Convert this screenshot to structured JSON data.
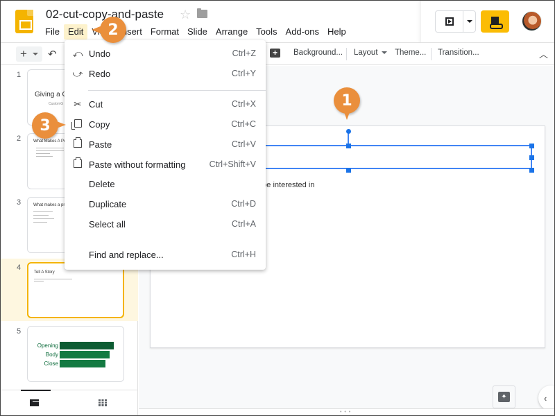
{
  "header": {
    "doc_title": "02-cut-copy-and-paste",
    "menu": [
      "File",
      "Edit",
      "View",
      "Insert",
      "Format",
      "Slide",
      "Arrange",
      "Tools",
      "Add-ons",
      "Help"
    ],
    "active_menu": "Edit"
  },
  "toolbar": {
    "new_slide": "+",
    "undo_icon": "↶",
    "comment_icon": "+",
    "background": "Background...",
    "layout": "Layout",
    "theme": "Theme...",
    "transition": "Transition...",
    "collapse_icon": "^"
  },
  "edit_menu": {
    "items": [
      {
        "label": "Undo",
        "shortcut": "Ctrl+Z",
        "icon": "undo-icon"
      },
      {
        "label": "Redo",
        "shortcut": "Ctrl+Y",
        "icon": "redo-icon"
      },
      {
        "label": "Cut",
        "shortcut": "Ctrl+X",
        "icon": "scissors-icon"
      },
      {
        "label": "Copy",
        "shortcut": "Ctrl+C",
        "icon": "copy-icon"
      },
      {
        "label": "Paste",
        "shortcut": "Ctrl+V",
        "icon": "paste-icon"
      },
      {
        "label": "Paste without formatting",
        "shortcut": "Ctrl+Shift+V",
        "icon": "paste-plain-icon"
      },
      {
        "label": "Delete",
        "shortcut": ""
      },
      {
        "label": "Duplicate",
        "shortcut": "Ctrl+D"
      },
      {
        "label": "Select all",
        "shortcut": "Ctrl+A"
      },
      {
        "label": "Find and replace...",
        "shortcut": "Ctrl+H"
      }
    ]
  },
  "filmstrip": {
    "slides": [
      {
        "number": "1",
        "title": "Giving a G",
        "subtitle": "CustomG"
      },
      {
        "number": "2",
        "title": "What Makes A Pre"
      },
      {
        "number": "3",
        "title": "What makes a pres"
      },
      {
        "number": "4",
        "title": "Tell A Story",
        "selected": true
      },
      {
        "number": "5",
        "bars": [
          {
            "label": "Opening",
            "value": 78
          },
          {
            "label": "Body",
            "value": 72
          },
          {
            "label": "Close",
            "value": 66
          }
        ]
      }
    ]
  },
  "canvas": {
    "slide_text": "o be interested in"
  },
  "callouts": [
    "1",
    "2",
    "3"
  ],
  "colors": {
    "accent_yellow": "#fbbc04",
    "selection_blue": "#1a73e8",
    "callout_orange": "#ea8f3c",
    "selected_slide_bg": "#fef7e0"
  }
}
